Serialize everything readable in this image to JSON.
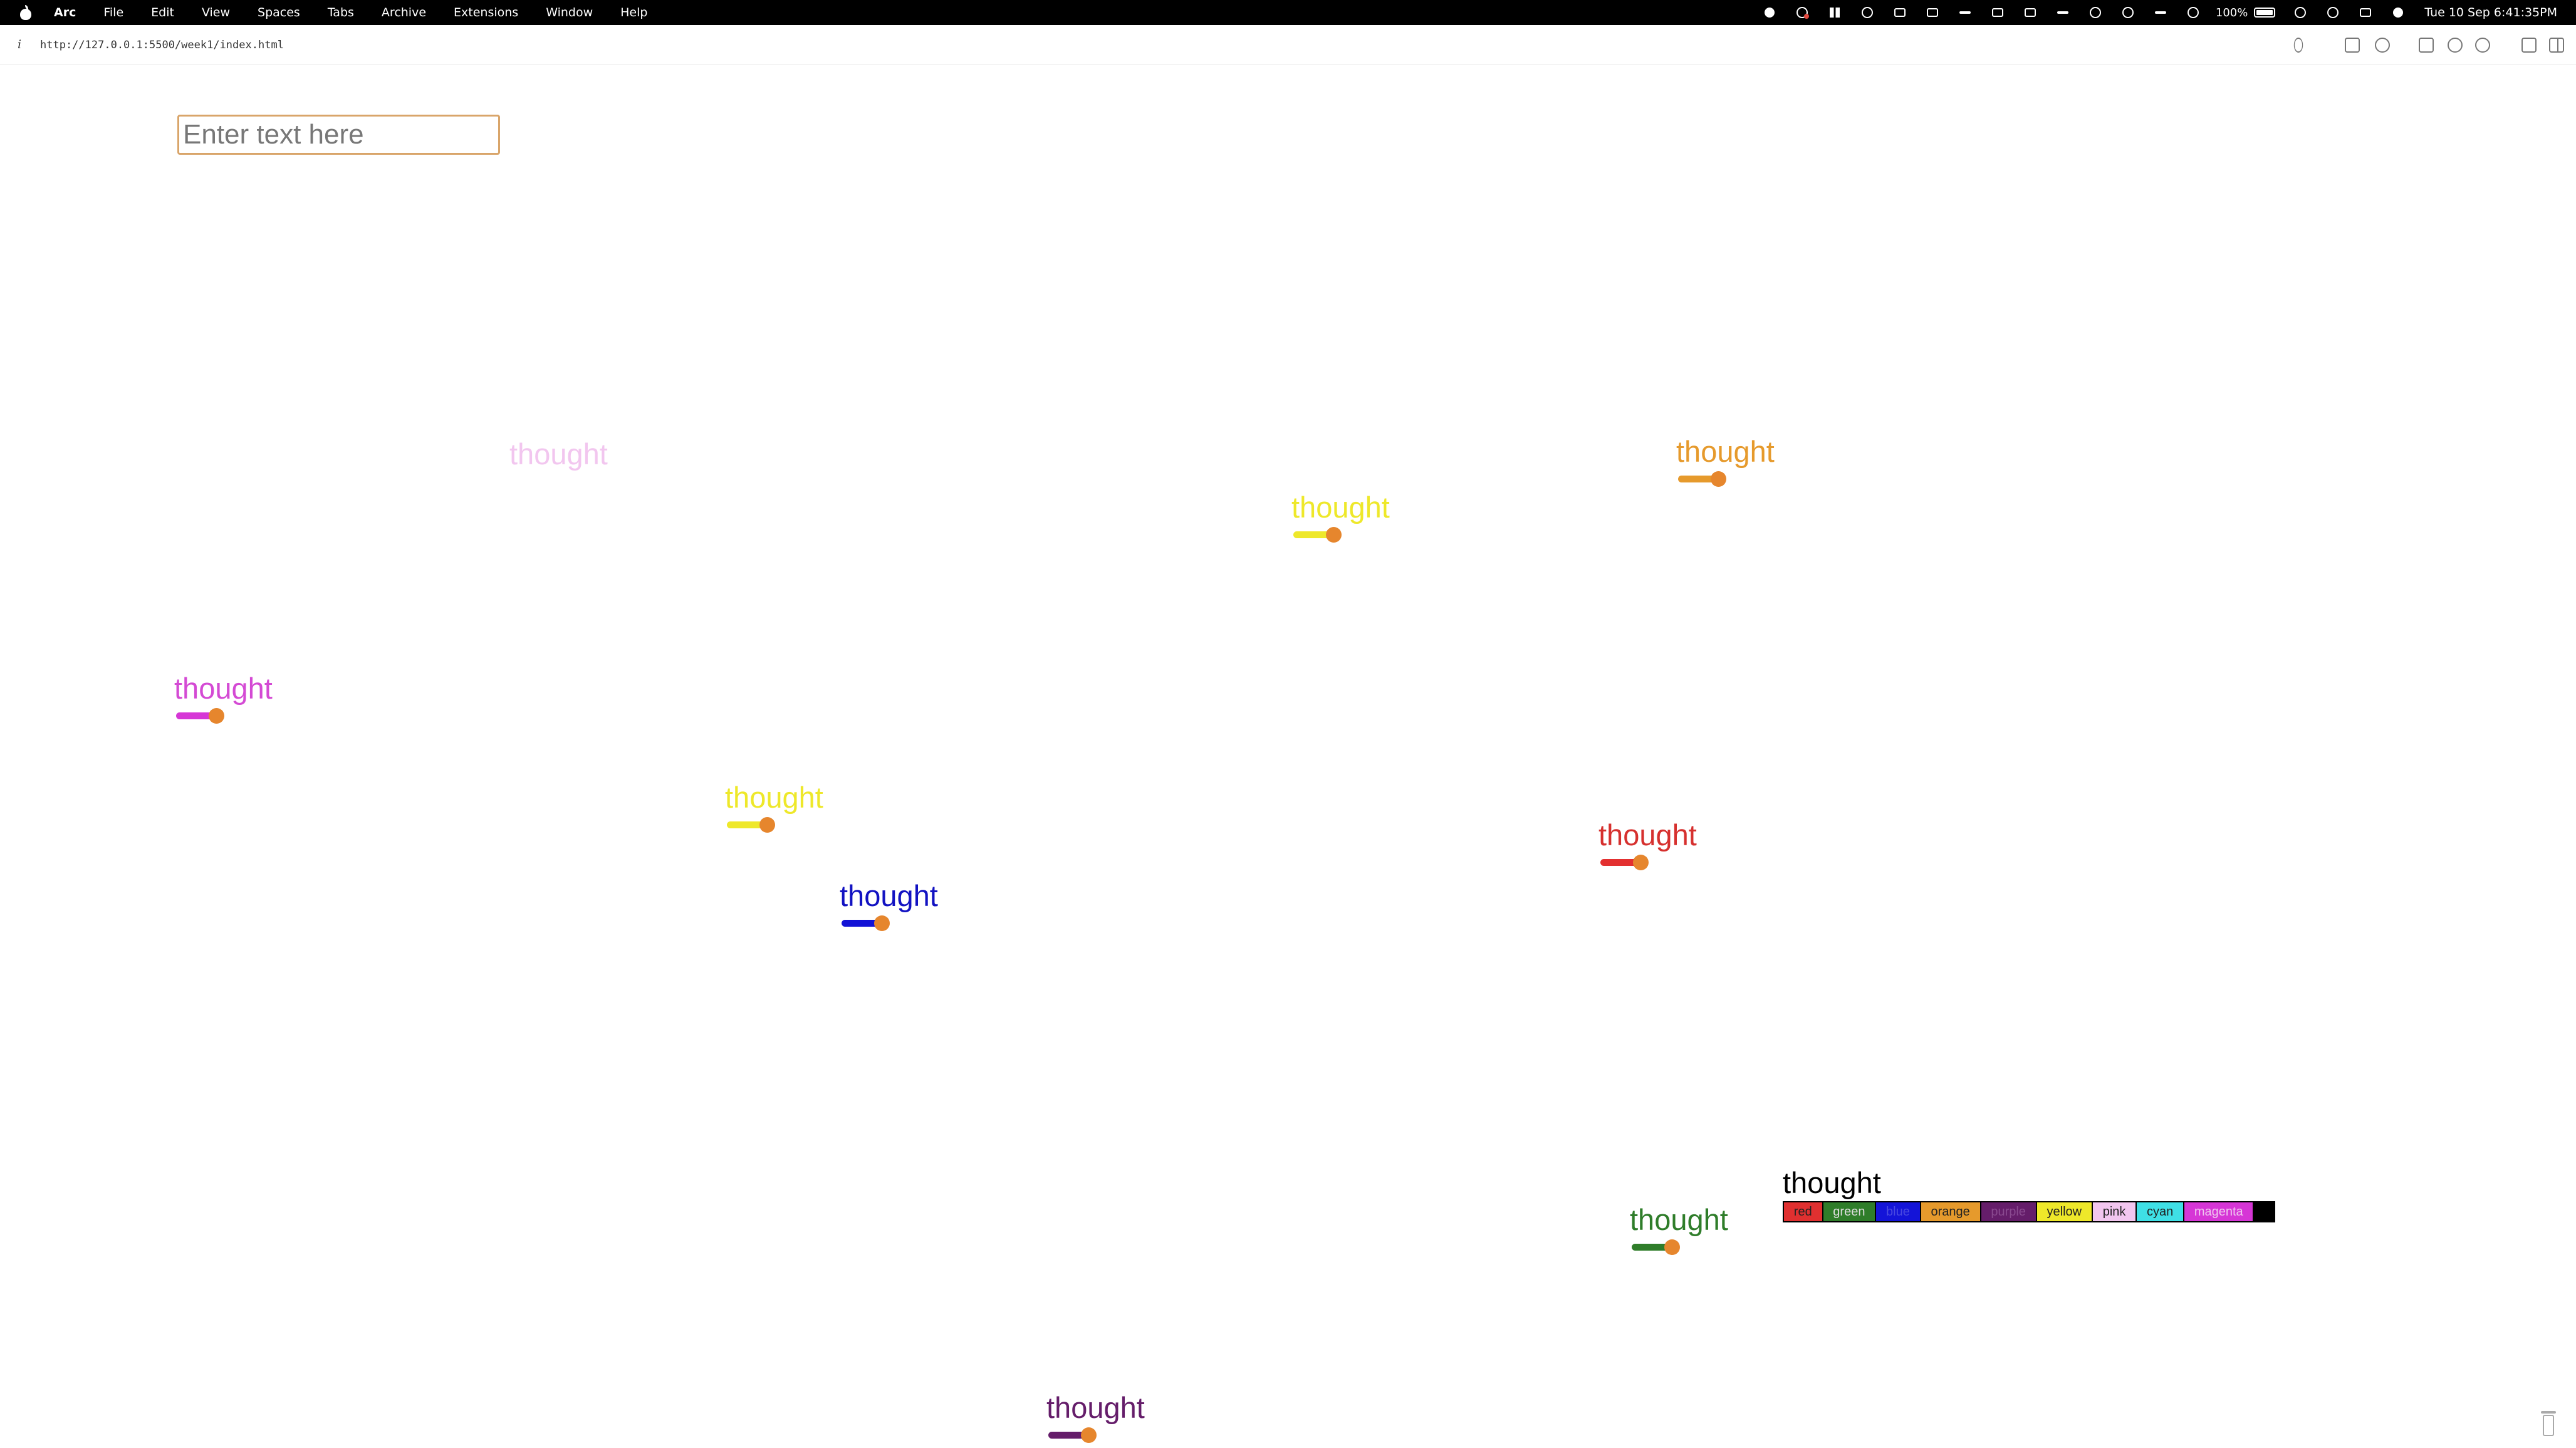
{
  "menubar": {
    "app_name": "Arc",
    "items": [
      "File",
      "Edit",
      "View",
      "Spaces",
      "Tabs",
      "Archive",
      "Extensions",
      "Window",
      "Help"
    ],
    "battery_percent": "100%",
    "clock": "Tue 10 Sep  6:41:35PM"
  },
  "browser": {
    "info_icon": "i",
    "url": "http://127.0.0.1:5500/week1/index.html"
  },
  "input": {
    "placeholder": "Enter text here",
    "value": ""
  },
  "thoughts": [
    {
      "text": "thought",
      "color": "#f2c6ef",
      "has_slider": false
    },
    {
      "text": "thought",
      "color": "#e69a2c",
      "track_color": "#e69a2c",
      "has_slider": true
    },
    {
      "text": "thought",
      "color": "#eee82a",
      "track_color": "#eee82a",
      "has_slider": true
    },
    {
      "text": "thought",
      "color": "#d44ad4",
      "track_color": "#d636d6",
      "has_slider": true
    },
    {
      "text": "thought",
      "color": "#eee82a",
      "track_color": "#eee82a",
      "has_slider": true
    },
    {
      "text": "thought",
      "color": "#d6302e",
      "track_color": "#e33030",
      "has_slider": true
    },
    {
      "text": "thought",
      "color": "#1212c2",
      "track_color": "#1212d6",
      "has_slider": true
    },
    {
      "text": "thought",
      "color": "#2f7d2a",
      "track_color": "#2f7d2a",
      "has_slider": true
    },
    {
      "text": "thought",
      "color": "#651d6a",
      "track_color": "#651d6a",
      "has_slider": true
    }
  ],
  "palette_thought": {
    "text": "thought",
    "colors": [
      {
        "label": "red",
        "bg": "#e03030",
        "fg": "#222222"
      },
      {
        "label": "green",
        "bg": "#2f7d2a",
        "fg": "#dddddd"
      },
      {
        "label": "blue",
        "bg": "#1414d8",
        "fg": "#4a4ae0"
      },
      {
        "label": "orange",
        "bg": "#e69a2c",
        "fg": "#222222"
      },
      {
        "label": "purple",
        "bg": "#651d6a",
        "fg": "#8a4a90"
      },
      {
        "label": "yellow",
        "bg": "#eee82a",
        "fg": "#222222"
      },
      {
        "label": "pink",
        "bg": "#f2c6ef",
        "fg": "#222222"
      },
      {
        "label": "cyan",
        "bg": "#3fe0e6",
        "fg": "#222222"
      },
      {
        "label": "magenta",
        "bg": "#d636d6",
        "fg": "#f0c8f0"
      },
      {
        "label": "",
        "bg": "#000000",
        "fg": "#000000"
      }
    ]
  }
}
